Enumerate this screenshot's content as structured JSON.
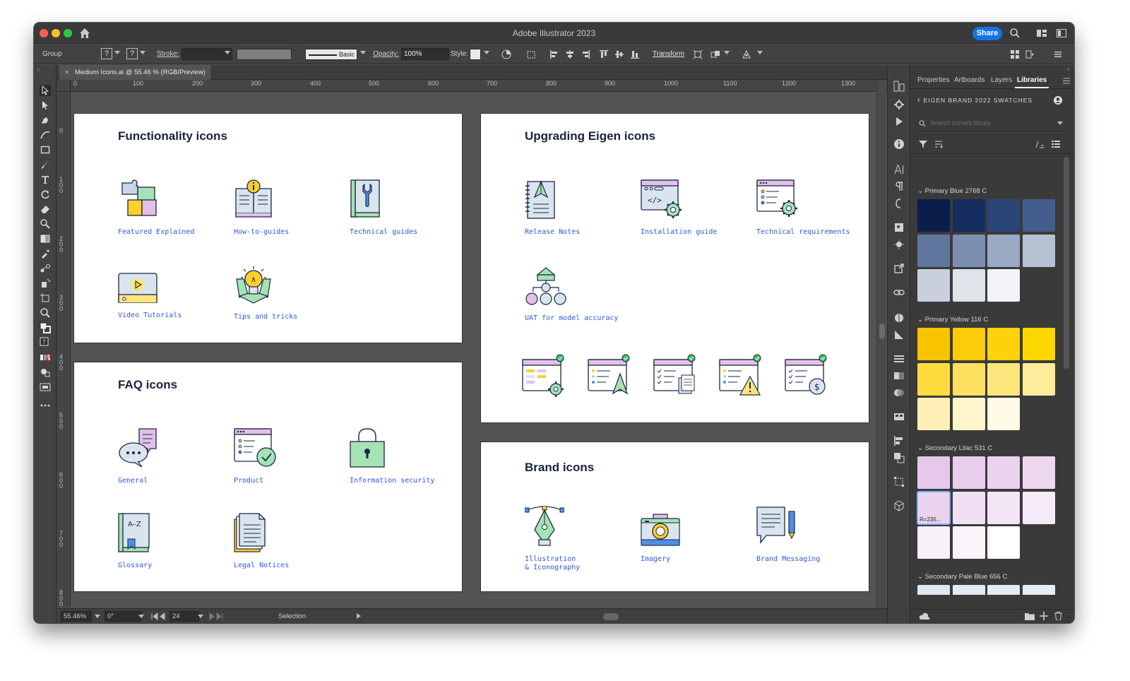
{
  "window": {
    "title": "Adobe Illustrator 2023",
    "share_label": "Share"
  },
  "control_bar": {
    "selection_type": "Group",
    "stroke_label": "Stroke:",
    "brush_label": "Basic",
    "opacity_label": "Opacity:",
    "opacity_value": "100%",
    "style_label": "Style:",
    "transform_label": "Transform"
  },
  "document_tab": {
    "close": "×",
    "title": "Medium Icons.ai @ 55.46 % (RGB/Preview)"
  },
  "rulers": {
    "horizontal": [
      "0",
      "100",
      "200",
      "300",
      "400",
      "500",
      "600",
      "700",
      "800",
      "900",
      "1000",
      "1100",
      "1200",
      "1300"
    ],
    "vertical": [
      "0",
      "100",
      "200",
      "300",
      "400",
      "500",
      "600",
      "700",
      "800"
    ]
  },
  "artboards": {
    "functionality": {
      "title": "Functionality icons",
      "items": [
        "Featured Explained",
        "How-to-guides",
        "Technical guides",
        "Video Tutorials",
        "Tips and tricks"
      ]
    },
    "faq": {
      "title": "FAQ icons",
      "items": [
        "General",
        "Product",
        "Information security",
        "Glossary",
        "Legal Notices"
      ],
      "glossary_glyph": "A–Z"
    },
    "upgrading": {
      "title": "Upgrading Eigen icons",
      "items": [
        "Release Notes",
        "Installation guide",
        "Technical requirements",
        "UAT for model accuracy"
      ],
      "currency_glyph": "$"
    },
    "brand": {
      "title": "Brand icons",
      "items": [
        "Illustration\n& Iconography",
        "Imagery",
        "Brand Messaging"
      ]
    }
  },
  "status_bar": {
    "zoom": "55.46%",
    "rotation": "0°",
    "artboard_number": "24",
    "tool": "Selection"
  },
  "panel": {
    "tabs": [
      "Properties",
      "Artboards",
      "Layers",
      "Libraries"
    ],
    "active_tab": "Libraries",
    "library_name": "EIGEN BRAND 2022 SWATCHES",
    "search_placeholder": "Search current library",
    "swatch_tooltip": "R=235...",
    "groups": [
      {
        "name": "Primary Blue 2768 C",
        "colors": [
          "#0b1d4a",
          "#152c5e",
          "#2a4677",
          "#435d8c",
          "#60769e",
          "#7c8fb1",
          "#9aa9c4",
          "#b6c1d4",
          "#c9d0dc",
          "#dfe3ea",
          "#f1f3f6"
        ]
      },
      {
        "name": "Primary Yellow 116 C",
        "colors": [
          "#f8c400",
          "#fccc0a",
          "#fdd20a",
          "#fdd800",
          "#fddb3f",
          "#fde05f",
          "#fde57d",
          "#feec9b",
          "#fef0b6",
          "#fef5cd",
          "#fffae6"
        ]
      },
      {
        "name": "Secondary Lilac 531 C",
        "colors": [
          "#e6c8ea",
          "#e9cdec",
          "#ebd2ee",
          "#eed8f0",
          "#ebd3ee",
          "#f1e0f3",
          "#f3e5f5",
          "#f5eaf7",
          "#f8f0f9",
          "#faf4fb",
          "#ffffff"
        ]
      },
      {
        "name": "Secondary Pale Blue 656 C",
        "colors": [
          "#dfe7f0",
          "#e2e9f2",
          "#e4ebf3",
          "#e6edf4",
          "#e9eff5",
          "#ebf1f6",
          "#edf2f7",
          "#eff4f8"
        ]
      }
    ]
  }
}
